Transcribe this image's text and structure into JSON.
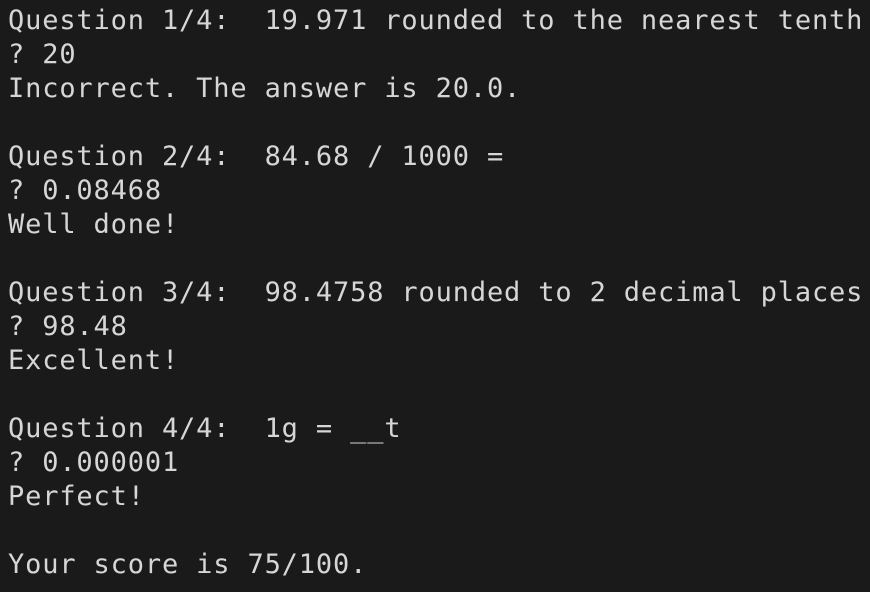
{
  "terminal": {
    "background_color": "#1a1a1a",
    "text_color": "#d6d6d6",
    "prompt_symbol": "?",
    "lines": [
      {
        "name": "question-1-prompt",
        "kind": "question",
        "text": "Question 1/4:  19.971 rounded to the nearest tenth"
      },
      {
        "name": "question-1-answer",
        "kind": "answer",
        "text": "? 20"
      },
      {
        "name": "question-1-feedback",
        "kind": "feedback",
        "text": "Incorrect. The answer is 20.0."
      },
      {
        "name": "blank-line-1",
        "kind": "blank",
        "text": ""
      },
      {
        "name": "question-2-prompt",
        "kind": "question",
        "text": "Question 2/4:  84.68 / 1000 ="
      },
      {
        "name": "question-2-answer",
        "kind": "answer",
        "text": "? 0.08468"
      },
      {
        "name": "question-2-feedback",
        "kind": "feedback",
        "text": "Well done!"
      },
      {
        "name": "blank-line-2",
        "kind": "blank",
        "text": ""
      },
      {
        "name": "question-3-prompt",
        "kind": "question",
        "text": "Question 3/4:  98.4758 rounded to 2 decimal places"
      },
      {
        "name": "question-3-answer",
        "kind": "answer",
        "text": "? 98.48"
      },
      {
        "name": "question-3-feedback",
        "kind": "feedback",
        "text": "Excellent!"
      },
      {
        "name": "blank-line-3",
        "kind": "blank",
        "text": ""
      },
      {
        "name": "question-4-prompt",
        "kind": "question",
        "text": "Question 4/4:  1g = __t"
      },
      {
        "name": "question-4-answer",
        "kind": "answer",
        "text": "? 0.000001"
      },
      {
        "name": "question-4-feedback",
        "kind": "feedback",
        "text": "Perfect!"
      },
      {
        "name": "blank-line-4",
        "kind": "blank",
        "text": ""
      },
      {
        "name": "final-score-line",
        "kind": "score",
        "text": "Your score is 75/100."
      }
    ]
  },
  "quiz": {
    "total_questions": "4",
    "score_text": "Your score is 75/100.",
    "score_value": "75",
    "score_max": "100",
    "questions": [
      {
        "index": "1/4",
        "prompt": "19.971 rounded to the nearest tenth",
        "answer": "20",
        "feedback": "Incorrect. The answer is 20.0.",
        "correct": "false"
      },
      {
        "index": "2/4",
        "prompt": "84.68 / 1000 =",
        "answer": "0.08468",
        "feedback": "Well done!",
        "correct": "true"
      },
      {
        "index": "3/4",
        "prompt": "98.4758 rounded to 2 decimal places",
        "answer": "98.48",
        "feedback": "Excellent!",
        "correct": "true"
      },
      {
        "index": "4/4",
        "prompt": "1g = __t",
        "answer": "0.000001",
        "feedback": "Perfect!",
        "correct": "true"
      }
    ]
  }
}
